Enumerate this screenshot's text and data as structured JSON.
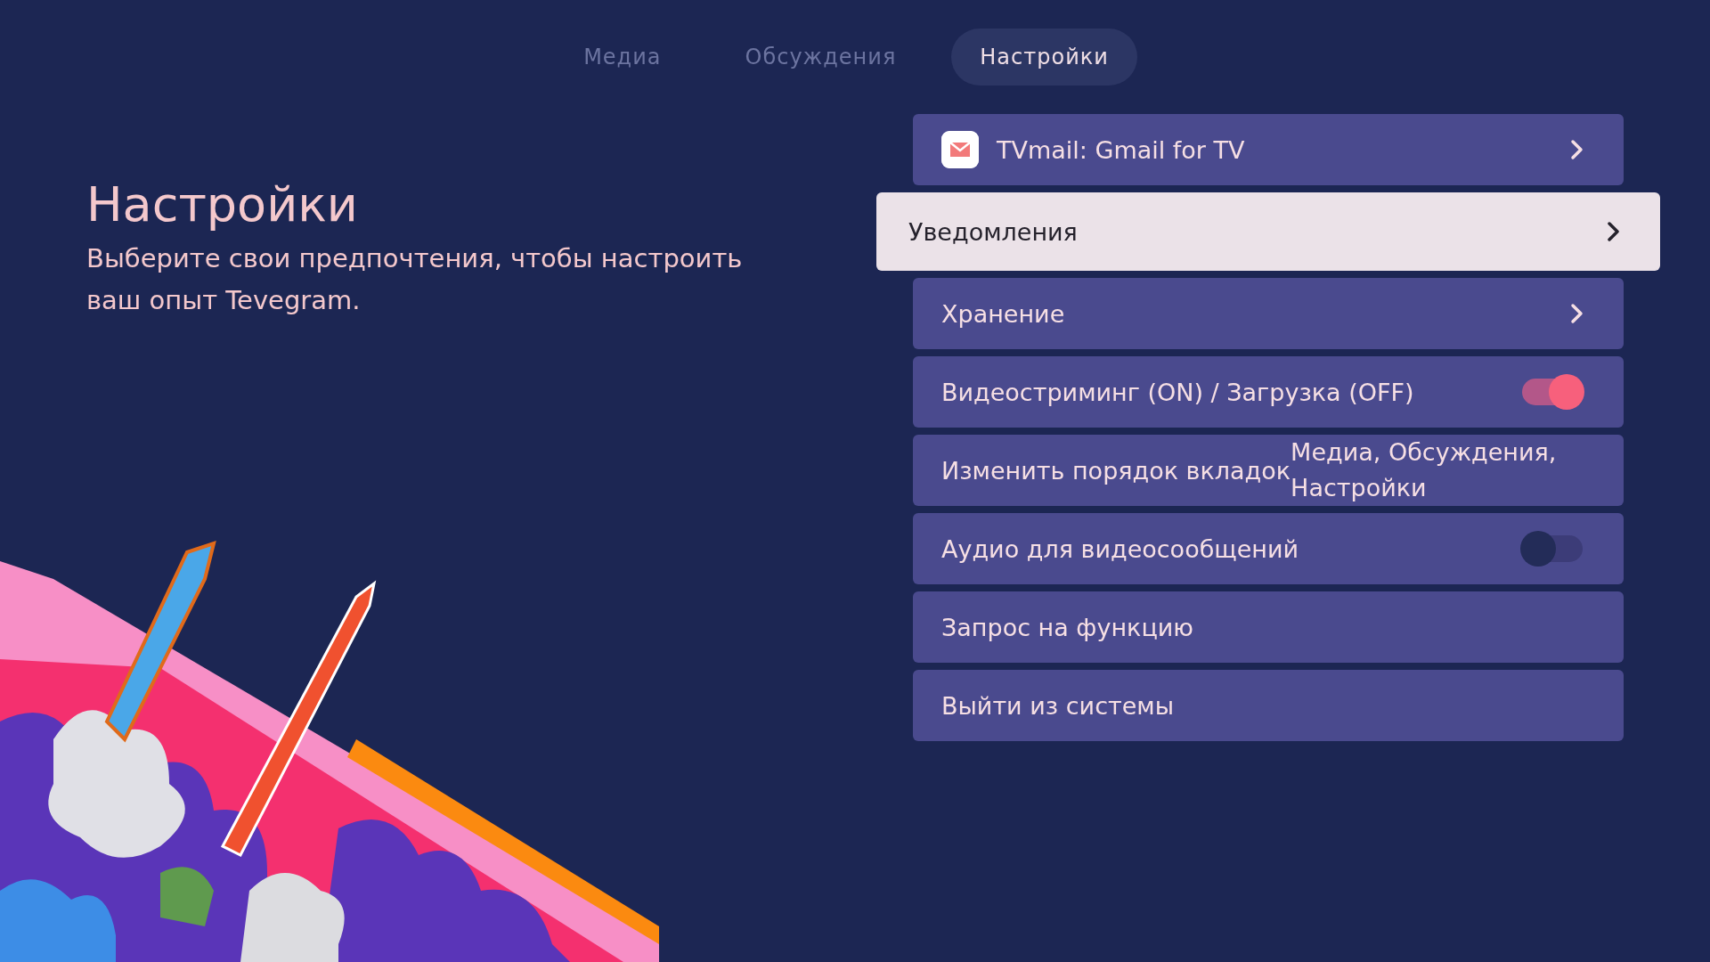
{
  "tabs": [
    {
      "label": "Медиа",
      "selected": false
    },
    {
      "label": "Обсуждения",
      "selected": false
    },
    {
      "label": "Настройки",
      "selected": true
    }
  ],
  "intro": {
    "title": "Настройки",
    "subtitle": "Выберите свои предпочтения, чтобы настроить ваш опыт Tevegram."
  },
  "settings": [
    {
      "kind": "app",
      "label": "TVmail: Gmail for TV",
      "selected": false
    },
    {
      "kind": "link",
      "label": "Уведомления",
      "selected": true
    },
    {
      "kind": "link",
      "label": "Хранение",
      "selected": false
    },
    {
      "kind": "toggle",
      "label": "Видеостриминг (ON) / Загрузка (OFF)",
      "on": true,
      "selected": false
    },
    {
      "kind": "value",
      "label": "Изменить порядок вкладок",
      "value": "Медиа, Обсуждения, Настройки",
      "selected": false
    },
    {
      "kind": "toggle",
      "label": "Аудио для видеосообщений",
      "on": false,
      "selected": false
    },
    {
      "kind": "plain",
      "label": "Запрос на функцию",
      "selected": false
    },
    {
      "kind": "plain",
      "label": "Выйти из системы",
      "selected": false
    }
  ]
}
